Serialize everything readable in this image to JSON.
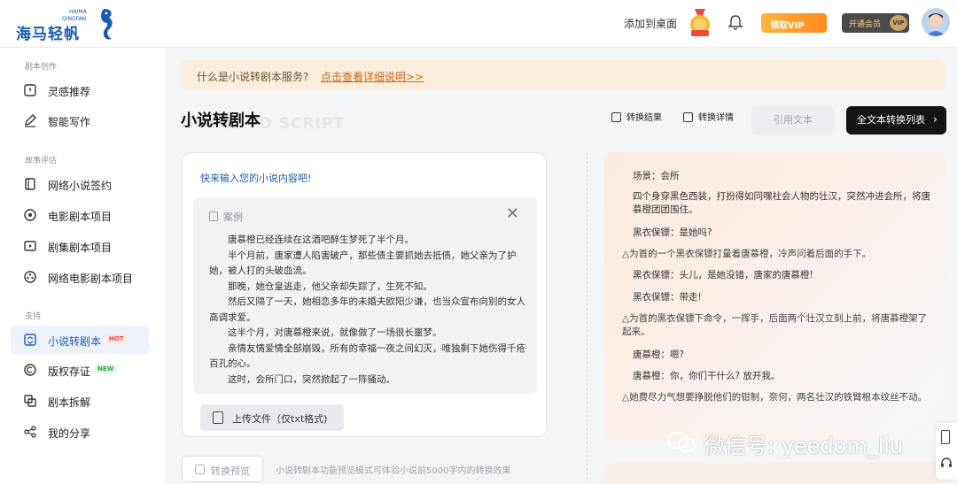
{
  "header": {
    "logo_cn": "海马轻帆",
    "logo_en_line1": "HAIMA",
    "logo_en_line2": "QINGFAN",
    "add_to_desktop": "添加到桌面",
    "vip_get_label": "领取VIP",
    "vip_open_label": "开通会员",
    "vip_tag": "VIP"
  },
  "sidebar": {
    "sections": [
      {
        "title": "剧本创作"
      },
      {
        "title": "故事评估"
      },
      {
        "title": "支持"
      }
    ],
    "items": [
      {
        "label": "灵感推荐",
        "icon": "inspiration-icon"
      },
      {
        "label": "智能写作",
        "icon": "pen-icon"
      },
      {
        "label": "网络小说签约",
        "icon": "book-icon"
      },
      {
        "label": "电影剧本项目",
        "icon": "film-icon"
      },
      {
        "label": "剧集剧本项目",
        "icon": "tv-icon"
      },
      {
        "label": "网络电影剧本项目",
        "icon": "web-film-icon"
      },
      {
        "label": "小说转剧本",
        "icon": "convert-icon",
        "badge": "HOT",
        "active": true
      },
      {
        "label": "版权存证",
        "icon": "copyright-icon",
        "badge": "NEW"
      },
      {
        "label": "剧本拆解",
        "icon": "split-icon"
      },
      {
        "label": "我的分享",
        "icon": "share-icon"
      }
    ]
  },
  "banner": {
    "question": "什么是小说转剧本服务?",
    "link": "点击查看详细说明>>"
  },
  "page": {
    "title": "小说转剧本",
    "title_en": "NOVEL TO SCRIPT"
  },
  "toolbar": {
    "result_label": "转换结果",
    "detail_label": "转换详情",
    "quote_label": "引用文本",
    "fulltext_label": "全文本转换列表",
    "fulltext_arrow": "›"
  },
  "input": {
    "prompt": "快来输入您的小说内容吧!",
    "example_label": "案例",
    "close": "✕",
    "paragraphs": [
      "唐慕橙已经连续在这酒吧醉生梦死了半个月。",
      "半个月前，唐家遭人陷害破产，那些债主要抓她去抵债，她父亲为了护她，被人打的头破血流。",
      "那晚，她仓皇逃走，他父亲却失踪了，生死不知。",
      "然后又隔了一天，她相恋多年的未婚夫欧阳少谦，也当众宣布向别的女人高调求爱。",
      "这半个月，对唐慕橙来说，就像做了一场很长噩梦。",
      "亲情友情爱情全部崩毁，所有的幸福一夜之间幻灭，唯独剩下她伤得千疮百孔的心。",
      "这时，会所门口，突然掀起了一阵骚动。"
    ],
    "upload_label": "上传文件（仅txt格式)",
    "preview_label": "转换预览",
    "preview_note": "小说转剧本功能预览模式可体验小说前5000字内的转换效果"
  },
  "result": {
    "lines": [
      {
        "kind": "role",
        "text": "场景：会所"
      },
      {
        "kind": "role",
        "text": "四个身穿黑色西装，打扮得如同嘿社会人物的壮汉，突然冲进会所，将唐慕橙团团围住。"
      },
      {
        "kind": "role",
        "text": "黑衣保镖：是她吗?"
      },
      {
        "kind": "act",
        "text": "△为首的一个黑衣保镖打量着唐慕橙，冷声问着后面的手下。"
      },
      {
        "kind": "role",
        "text": "黑衣保镖：头儿，是她没错，唐家的唐慕橙!"
      },
      {
        "kind": "role",
        "text": "黑衣保镖：带走!"
      },
      {
        "kind": "act",
        "text": "△为首的黑衣保镖下命令，一挥手，后面两个壮汉立刻上前，将唐慕橙架了起来。"
      },
      {
        "kind": "role",
        "text": "唐慕橙：嗯?"
      },
      {
        "kind": "role",
        "text": "唐慕橙：你，你们干什么? 放开我。"
      },
      {
        "kind": "act",
        "text": "△她费尽力气想要挣脱他们的钳制，奈何，两名壮汉的铁臂根本纹丝不动。"
      }
    ]
  },
  "watermark": "微信号: yeedom_liu",
  "colors": {
    "brand": "#1a5bb3",
    "banner_bg": "#fbeedc",
    "link": "#c9671b",
    "hot": "#e64b3c",
    "new": "#2ea64d"
  }
}
